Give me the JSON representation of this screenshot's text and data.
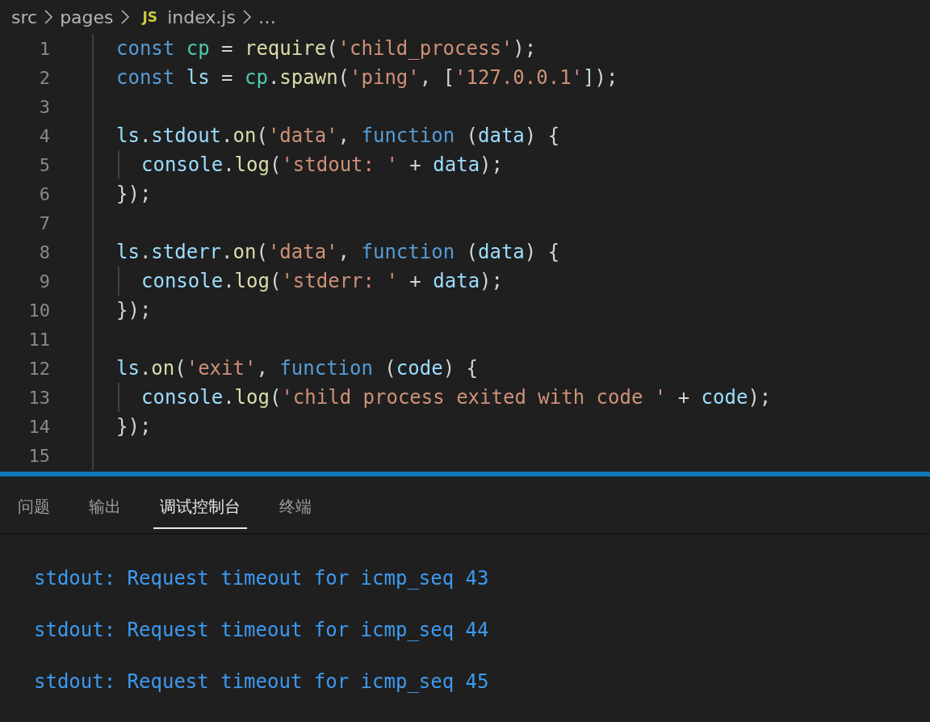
{
  "breadcrumb": [
    {
      "kind": "folder",
      "text": "src"
    },
    {
      "kind": "folder",
      "text": "pages"
    },
    {
      "kind": "js-file",
      "badge": "JS",
      "text": "index.js"
    },
    {
      "kind": "more",
      "text": "…"
    }
  ],
  "editor": {
    "lines": [
      {
        "number": "1",
        "tokens": [
          {
            "kind": "keyword",
            "text": "const "
          },
          {
            "kind": "module",
            "text": "cp"
          },
          {
            "kind": "plain",
            "text": " = "
          },
          {
            "kind": "function",
            "text": "require"
          },
          {
            "kind": "plain",
            "text": "("
          },
          {
            "kind": "string",
            "text": "'child_process'"
          },
          {
            "kind": "plain",
            "text": ");"
          }
        ]
      },
      {
        "number": "2",
        "tokens": [
          {
            "kind": "keyword",
            "text": "const "
          },
          {
            "kind": "variable",
            "text": "ls"
          },
          {
            "kind": "plain",
            "text": " = "
          },
          {
            "kind": "module",
            "text": "cp"
          },
          {
            "kind": "plain",
            "text": "."
          },
          {
            "kind": "function",
            "text": "spawn"
          },
          {
            "kind": "plain",
            "text": "("
          },
          {
            "kind": "string",
            "text": "'ping'"
          },
          {
            "kind": "plain",
            "text": ", ["
          },
          {
            "kind": "string",
            "text": "'127.0.0.1'"
          },
          {
            "kind": "plain",
            "text": "]);"
          }
        ]
      },
      {
        "number": "3"
      },
      {
        "number": "4",
        "tokens": [
          {
            "kind": "variable",
            "text": "ls"
          },
          {
            "kind": "plain",
            "text": "."
          },
          {
            "kind": "variable",
            "text": "stdout"
          },
          {
            "kind": "plain",
            "text": "."
          },
          {
            "kind": "function",
            "text": "on"
          },
          {
            "kind": "plain",
            "text": "("
          },
          {
            "kind": "string",
            "text": "'data'"
          },
          {
            "kind": "plain",
            "text": ", "
          },
          {
            "kind": "keyword",
            "text": "function"
          },
          {
            "kind": "plain",
            "text": " ("
          },
          {
            "kind": "variable",
            "text": "data"
          },
          {
            "kind": "plain",
            "text": ") {"
          }
        ]
      },
      {
        "number": "5",
        "indented": true,
        "tokens": [
          {
            "kind": "variable",
            "text": "console"
          },
          {
            "kind": "plain",
            "text": "."
          },
          {
            "kind": "function",
            "text": "log"
          },
          {
            "kind": "plain",
            "text": "("
          },
          {
            "kind": "string",
            "text": "'stdout: '"
          },
          {
            "kind": "plain",
            "text": " + "
          },
          {
            "kind": "variable",
            "text": "data"
          },
          {
            "kind": "plain",
            "text": ");"
          }
        ]
      },
      {
        "number": "6",
        "tokens": [
          {
            "kind": "plain",
            "text": "});"
          }
        ]
      },
      {
        "number": "7"
      },
      {
        "number": "8",
        "tokens": [
          {
            "kind": "variable",
            "text": "ls"
          },
          {
            "kind": "plain",
            "text": "."
          },
          {
            "kind": "variable",
            "text": "stderr"
          },
          {
            "kind": "plain",
            "text": "."
          },
          {
            "kind": "function",
            "text": "on"
          },
          {
            "kind": "plain",
            "text": "("
          },
          {
            "kind": "string",
            "text": "'data'"
          },
          {
            "kind": "plain",
            "text": ", "
          },
          {
            "kind": "keyword",
            "text": "function"
          },
          {
            "kind": "plain",
            "text": " ("
          },
          {
            "kind": "variable",
            "text": "data"
          },
          {
            "kind": "plain",
            "text": ") {"
          }
        ]
      },
      {
        "number": "9",
        "indented": true,
        "tokens": [
          {
            "kind": "variable",
            "text": "console"
          },
          {
            "kind": "plain",
            "text": "."
          },
          {
            "kind": "function",
            "text": "log"
          },
          {
            "kind": "plain",
            "text": "("
          },
          {
            "kind": "string",
            "text": "'stderr: '"
          },
          {
            "kind": "plain",
            "text": " + "
          },
          {
            "kind": "variable",
            "text": "data"
          },
          {
            "kind": "plain",
            "text": ");"
          }
        ]
      },
      {
        "number": "10",
        "tokens": [
          {
            "kind": "plain",
            "text": "});"
          }
        ]
      },
      {
        "number": "11"
      },
      {
        "number": "12",
        "tokens": [
          {
            "kind": "variable",
            "text": "ls"
          },
          {
            "kind": "plain",
            "text": "."
          },
          {
            "kind": "function",
            "text": "on"
          },
          {
            "kind": "plain",
            "text": "("
          },
          {
            "kind": "string",
            "text": "'exit'"
          },
          {
            "kind": "plain",
            "text": ", "
          },
          {
            "kind": "keyword",
            "text": "function"
          },
          {
            "kind": "plain",
            "text": " ("
          },
          {
            "kind": "variable",
            "text": "code"
          },
          {
            "kind": "plain",
            "text": ") {"
          }
        ]
      },
      {
        "number": "13",
        "indented": true,
        "tokens": [
          {
            "kind": "variable",
            "text": "console"
          },
          {
            "kind": "plain",
            "text": "."
          },
          {
            "kind": "function",
            "text": "log"
          },
          {
            "kind": "plain",
            "text": "("
          },
          {
            "kind": "string",
            "text": "'child process exited with code '"
          },
          {
            "kind": "plain",
            "text": " + "
          },
          {
            "kind": "variable",
            "text": "code"
          },
          {
            "kind": "plain",
            "text": ");"
          }
        ]
      },
      {
        "number": "14",
        "tokens": [
          {
            "kind": "plain",
            "text": "});"
          }
        ]
      },
      {
        "number": "15"
      }
    ]
  },
  "panel": {
    "tabs": [
      {
        "label": "问题",
        "selected": false
      },
      {
        "label": "输出",
        "selected": false
      },
      {
        "label": "调试控制台",
        "selected": true
      },
      {
        "label": "终端",
        "selected": false
      }
    ],
    "console_lines": [
      "stdout: Request timeout for icmp_seq 43",
      "stdout: Request timeout for icmp_seq 44",
      "stdout: Request timeout for icmp_seq 45"
    ]
  }
}
